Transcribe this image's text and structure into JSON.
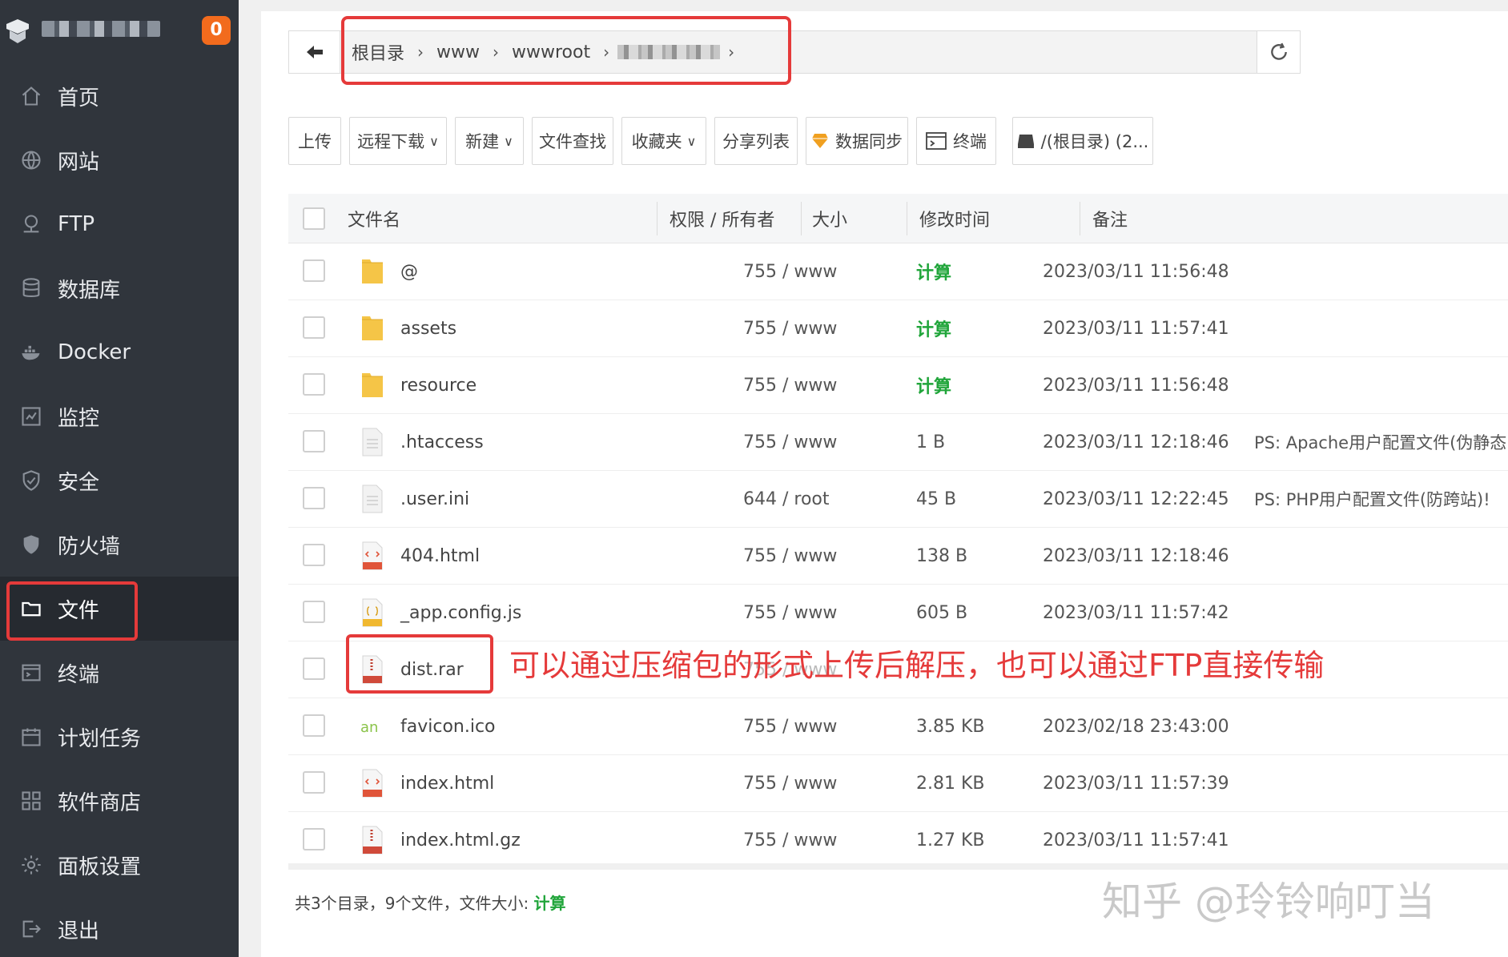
{
  "sidebar": {
    "badge": "0",
    "items": [
      {
        "label": "首页",
        "icon": "home-icon"
      },
      {
        "label": "网站",
        "icon": "globe-icon"
      },
      {
        "label": "FTP",
        "icon": "ftp-icon"
      },
      {
        "label": "数据库",
        "icon": "database-icon"
      },
      {
        "label": "Docker",
        "icon": "docker-icon"
      },
      {
        "label": "监控",
        "icon": "monitor-icon"
      },
      {
        "label": "安全",
        "icon": "shield-check-icon"
      },
      {
        "label": "防火墙",
        "icon": "shield-icon"
      },
      {
        "label": "文件",
        "icon": "folder-icon"
      },
      {
        "label": "终端",
        "icon": "terminal-icon"
      },
      {
        "label": "计划任务",
        "icon": "calendar-icon"
      },
      {
        "label": "软件商店",
        "icon": "grid-icon"
      },
      {
        "label": "面板设置",
        "icon": "gear-icon"
      },
      {
        "label": "退出",
        "icon": "logout-icon"
      }
    ],
    "active_index": 8
  },
  "path": {
    "crumbs": [
      "根目录",
      "www",
      "wwwroot"
    ]
  },
  "toolbar": {
    "upload": "上传",
    "remote_download": "远程下载",
    "new": "新建",
    "find": "文件查找",
    "favorites": "收藏夹",
    "share_list": "分享列表",
    "data_sync": "数据同步",
    "terminal": "终端",
    "disk": "/(根目录) (2..."
  },
  "table": {
    "headers": {
      "name": "文件名",
      "perm": "权限 / 所有者",
      "size": "大小",
      "mtime": "修改时间",
      "note": "备注"
    },
    "rows": [
      {
        "name": "@",
        "type": "folder",
        "perm": "755 / www",
        "size": "计算",
        "mtime": "2023/03/11 11:56:48",
        "note": ""
      },
      {
        "name": "assets",
        "type": "folder",
        "perm": "755 / www",
        "size": "计算",
        "mtime": "2023/03/11 11:57:41",
        "note": ""
      },
      {
        "name": "resource",
        "type": "folder",
        "perm": "755 / www",
        "size": "计算",
        "mtime": "2023/03/11 11:56:48",
        "note": ""
      },
      {
        "name": ".htaccess",
        "type": "text",
        "perm": "755 / www",
        "size": "1 B",
        "mtime": "2023/03/11 12:18:46",
        "note": "PS: Apache用户配置文件(伪静态"
      },
      {
        "name": ".user.ini",
        "type": "text",
        "perm": "644 / root",
        "size": "45 B",
        "mtime": "2023/03/11 12:22:45",
        "note": "PS: PHP用户配置文件(防跨站)!"
      },
      {
        "name": "404.html",
        "type": "html",
        "perm": "755 / www",
        "size": "138 B",
        "mtime": "2023/03/11 12:18:46",
        "note": ""
      },
      {
        "name": "_app.config.js",
        "type": "js",
        "perm": "755 / www",
        "size": "605 B",
        "mtime": "2023/03/11 11:57:42",
        "note": ""
      },
      {
        "name": "dist.rar",
        "type": "rar",
        "perm": "755 / www",
        "size": "",
        "mtime": "",
        "note": ""
      },
      {
        "name": "favicon.ico",
        "type": "ico",
        "perm": "755 / www",
        "size": "3.85 KB",
        "mtime": "2023/02/18 23:43:00",
        "note": ""
      },
      {
        "name": "index.html",
        "type": "html",
        "perm": "755 / www",
        "size": "2.81 KB",
        "mtime": "2023/03/11 11:57:39",
        "note": ""
      },
      {
        "name": "index.html.gz",
        "type": "gz",
        "perm": "755 / www",
        "size": "1.27 KB",
        "mtime": "2023/03/11 11:57:41",
        "note": ""
      }
    ]
  },
  "annotation": "可以通过压缩包的形式上传后解压，也可以通过FTP直接传输",
  "summary": {
    "text": "共3个目录，9个文件，文件大小: ",
    "calc": "计算"
  },
  "watermark": "知乎 @玲铃响叮当",
  "colors": {
    "sidebar_bg": "#30353c",
    "accent_green": "#20a53a",
    "badge_orange": "#f26b1d",
    "highlight_red": "#e53a3a"
  }
}
